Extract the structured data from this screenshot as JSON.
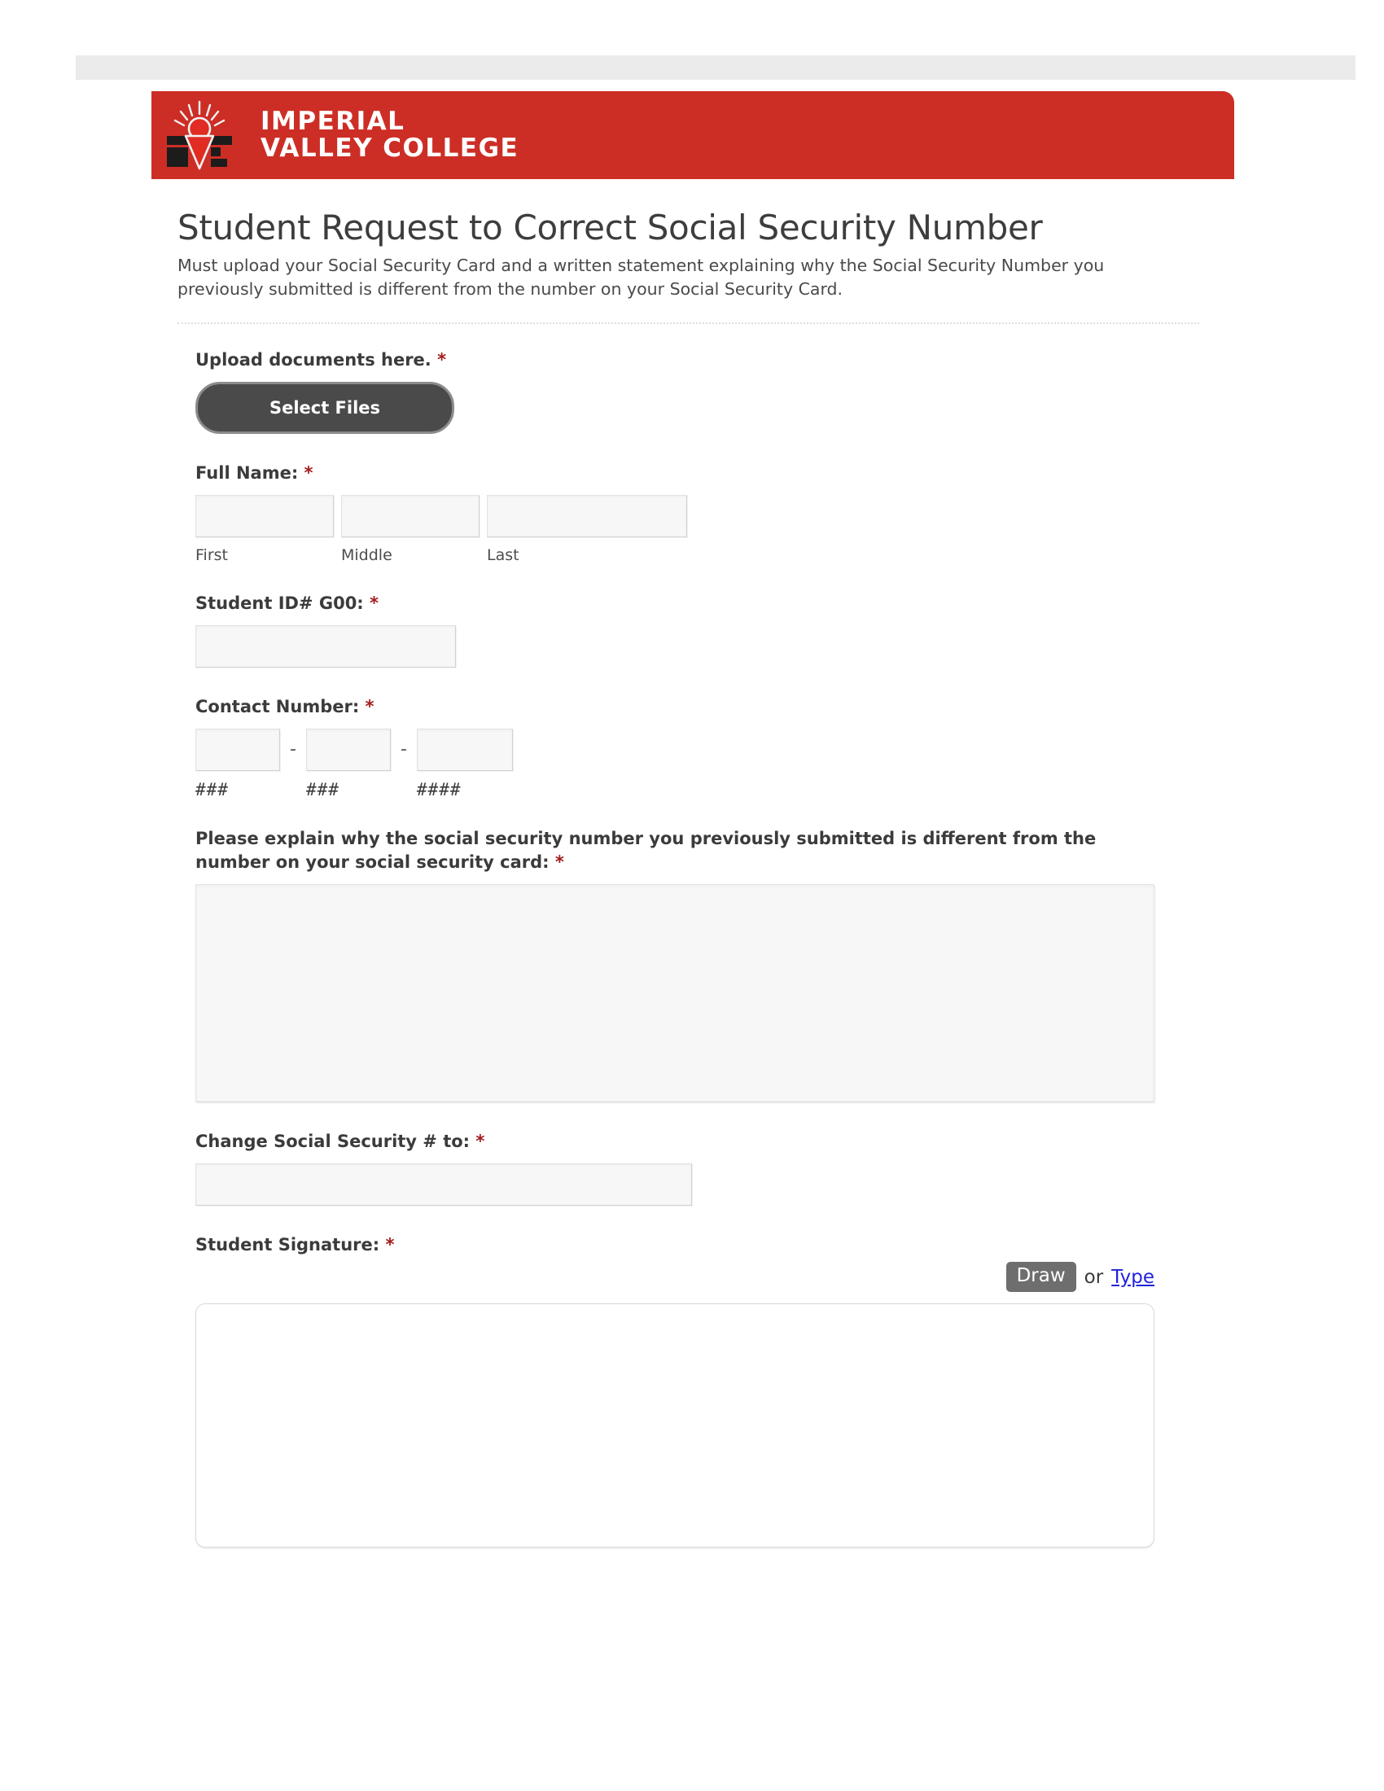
{
  "brand": {
    "line1": "IMPERIAL",
    "line2": "VALLEY COLLEGE",
    "logo_icon": "ivc-sun-monogram-logo",
    "banner_color": "#cc2e26"
  },
  "form": {
    "title": "Student Request to Correct Social Security Number",
    "subtitle": "Must upload your Social Security Card and a written statement explaining why the Social Security Number you previously submitted is different from the number on your Social Security Card.",
    "required_marker": "*"
  },
  "upload": {
    "label": "Upload documents here.",
    "button_label": "Select Files"
  },
  "full_name": {
    "label": "Full Name:",
    "first": {
      "value": "",
      "placeholder": "",
      "sub_label": "First"
    },
    "middle": {
      "value": "",
      "placeholder": "",
      "sub_label": "Middle"
    },
    "last": {
      "value": "",
      "placeholder": "",
      "sub_label": "Last"
    }
  },
  "student_id": {
    "label": "Student ID# G00:",
    "value": "",
    "placeholder": ""
  },
  "contact_number": {
    "label": "Contact Number:",
    "separator": "-",
    "part1": {
      "value": "",
      "placeholder": "",
      "sub_label": "###"
    },
    "part2": {
      "value": "",
      "placeholder": "",
      "sub_label": "###"
    },
    "part3": {
      "value": "",
      "placeholder": "",
      "sub_label": "####"
    }
  },
  "explanation": {
    "label": "Please explain why the social security number you previously submitted is different from the number on your social security card:",
    "value": "",
    "placeholder": ""
  },
  "change_ssn": {
    "label": "Change Social Security # to:",
    "value": "",
    "placeholder": ""
  },
  "signature": {
    "label": "Student Signature:",
    "draw_label": "Draw",
    "or_label": "or",
    "type_label": "Type",
    "active_mode": "Draw",
    "link_color": "#2222dd"
  }
}
